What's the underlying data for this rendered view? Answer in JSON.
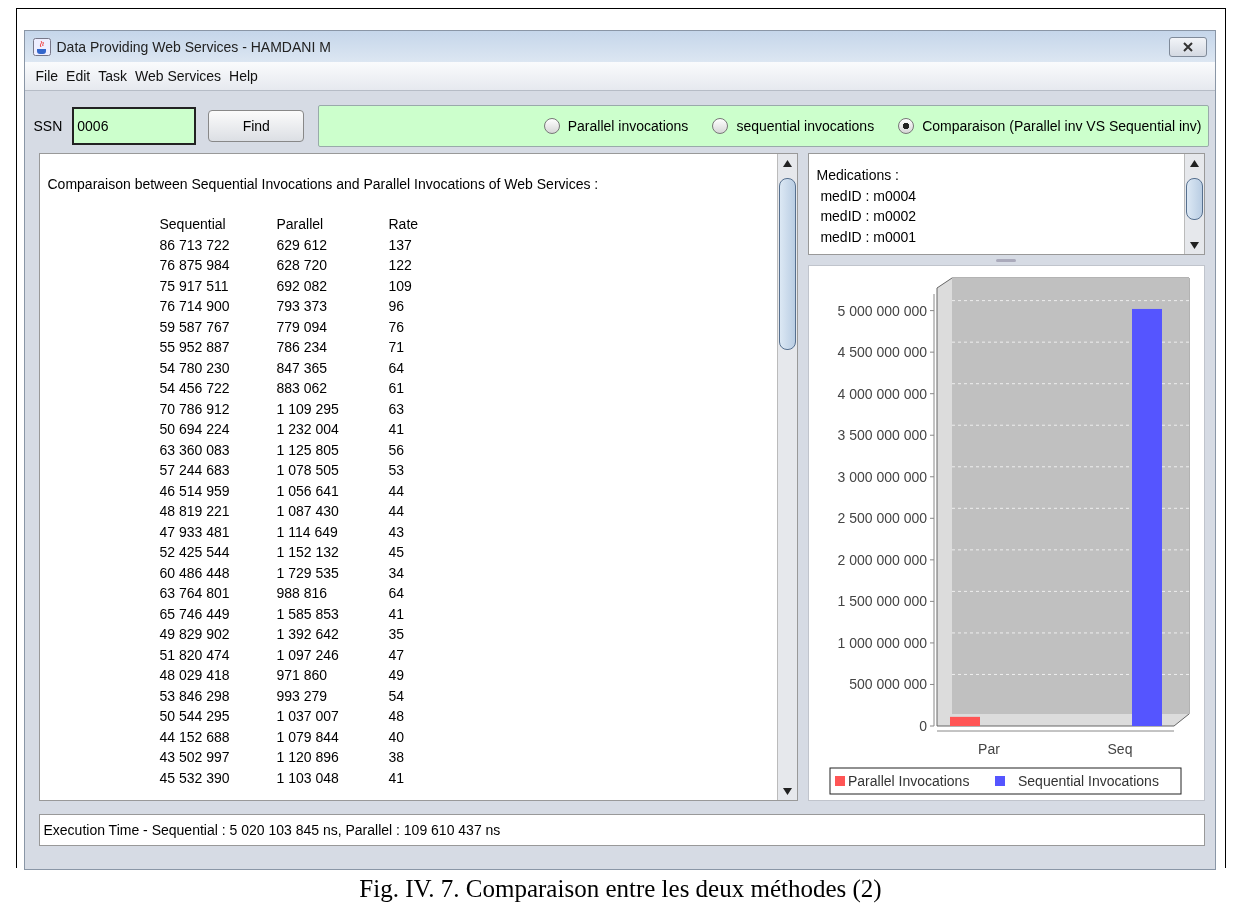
{
  "window": {
    "title": "Data Providing Web Services - HAMDANI M"
  },
  "menu": [
    "File",
    "Edit",
    "Task",
    "Web Services",
    "Help"
  ],
  "toolbar": {
    "ssn_label": "SSN",
    "ssn_value": "0006",
    "find_button": "Find",
    "modes": [
      {
        "label": "Parallel invocations",
        "selected": false
      },
      {
        "label": "sequential invocations",
        "selected": false
      },
      {
        "label": "Comparaison (Parallel inv VS Sequential inv)",
        "selected": true
      }
    ]
  },
  "results": {
    "heading": "Comparaison between Sequential Invocations and Parallel Invocations of Web Services :",
    "columns": [
      "Sequential",
      "Parallel",
      "Rate"
    ],
    "rows": [
      [
        "86 713 722",
        "629 612",
        "137"
      ],
      [
        "76 875 984",
        "628 720",
        "122"
      ],
      [
        "75 917 511",
        "692 082",
        "109"
      ],
      [
        "76 714 900",
        "793 373",
        "96"
      ],
      [
        "59 587 767",
        "779 094",
        "76"
      ],
      [
        "55 952 887",
        "786 234",
        "71"
      ],
      [
        "54 780 230",
        "847 365",
        "64"
      ],
      [
        "54 456 722",
        "883 062",
        "61"
      ],
      [
        "70 786 912",
        "1 109 295",
        "63"
      ],
      [
        "50 694 224",
        "1 232 004",
        "41"
      ],
      [
        "63 360 083",
        "1 125 805",
        "56"
      ],
      [
        "57 244 683",
        "1 078 505",
        "53"
      ],
      [
        "46 514 959",
        "1 056 641",
        "44"
      ],
      [
        "48 819 221",
        "1 087 430",
        "44"
      ],
      [
        "47 933 481",
        "1 114 649",
        "43"
      ],
      [
        "52 425 544",
        "1 152 132",
        "45"
      ],
      [
        "60 486 448",
        "1 729 535",
        "34"
      ],
      [
        "63 764 801",
        "988 816",
        "64"
      ],
      [
        "65 746 449",
        "1 585 853",
        "41"
      ],
      [
        "49 829 902",
        "1 392 642",
        "35"
      ],
      [
        "51 820 474",
        "1 097 246",
        "47"
      ],
      [
        "48 029 418",
        "971 860",
        "49"
      ],
      [
        "53 846 298",
        "993 279",
        "54"
      ],
      [
        "50 544 295",
        "1 037 007",
        "48"
      ],
      [
        "44 152 688",
        "1 079 844",
        "40"
      ],
      [
        "43 502 997",
        "1 120 896",
        "38"
      ],
      [
        "45 532 390",
        "1 103 048",
        "41"
      ]
    ]
  },
  "medications": {
    "title": "Medications :",
    "items": [
      "medID : m0004",
      "medID : m0002",
      "medID : m0001"
    ]
  },
  "chart": {
    "chart_data": {
      "type": "bar",
      "categories": [
        "Par",
        "Seq"
      ],
      "series": [
        {
          "name": "Parallel Invocations",
          "color": "#ff5555",
          "values": [
            110000000,
            null
          ]
        },
        {
          "name": "Sequential Invocations",
          "color": "#5555ff",
          "values": [
            null,
            5020000000
          ]
        }
      ],
      "ylim": [
        0,
        5200000000
      ],
      "grid": true,
      "legend": "bottom",
      "yticks": [
        {
          "value": 0,
          "label": "0"
        },
        {
          "value": 500000000,
          "label": "500 000 000"
        },
        {
          "value": 1000000000,
          "label": "1 000 000 000"
        },
        {
          "value": 1500000000,
          "label": "1 500 000 000"
        },
        {
          "value": 2000000000,
          "label": "2 000 000 000"
        },
        {
          "value": 2500000000,
          "label": "2 500 000 000"
        },
        {
          "value": 3000000000,
          "label": "3 000 000 000"
        },
        {
          "value": 3500000000,
          "label": "3 500 000 000"
        },
        {
          "value": 4000000000,
          "label": "4 000 000 000"
        },
        {
          "value": 4500000000,
          "label": "4 500 000 000"
        },
        {
          "value": 5000000000,
          "label": "5 000 000 000"
        }
      ]
    }
  },
  "status_bar": "Execution Time -  Sequential  : 5 020 103 845 ns, Parallel : 109 610 437 ns",
  "caption": "Fig. IV. 7. Comparaison entre les deux méthodes (2)"
}
